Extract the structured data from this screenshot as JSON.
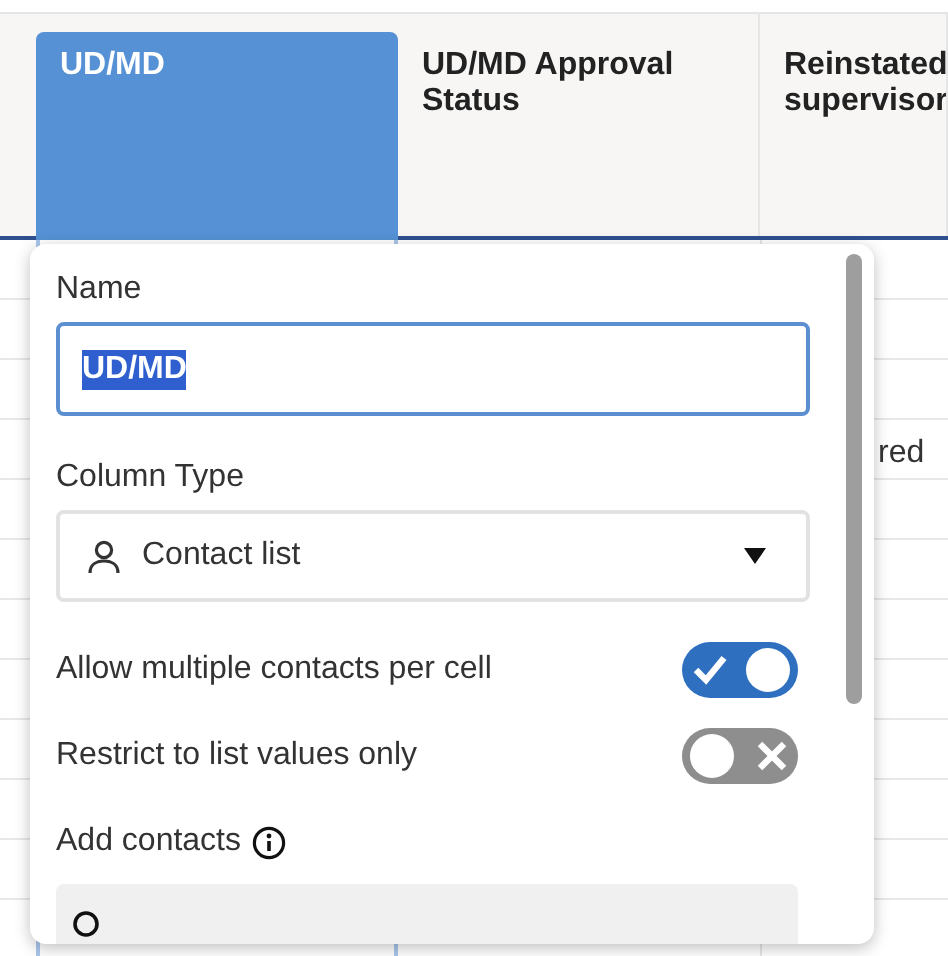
{
  "table": {
    "columns": [
      {
        "label": "UD/MD",
        "selected": true
      },
      {
        "label": "UD/MD Approval Status",
        "selected": false
      },
      {
        "label": "Reinstated supervisor",
        "selected": false
      }
    ],
    "visible_cell_text": "red"
  },
  "column_editor": {
    "name_label": "Name",
    "name_value": "UD/MD",
    "type_label": "Column Type",
    "type_value": "Contact list",
    "toggles": [
      {
        "label": "Allow multiple contacts per cell",
        "on": true
      },
      {
        "label": "Restrict to list values only",
        "on": false
      }
    ],
    "contacts_label": "Add contacts"
  }
}
